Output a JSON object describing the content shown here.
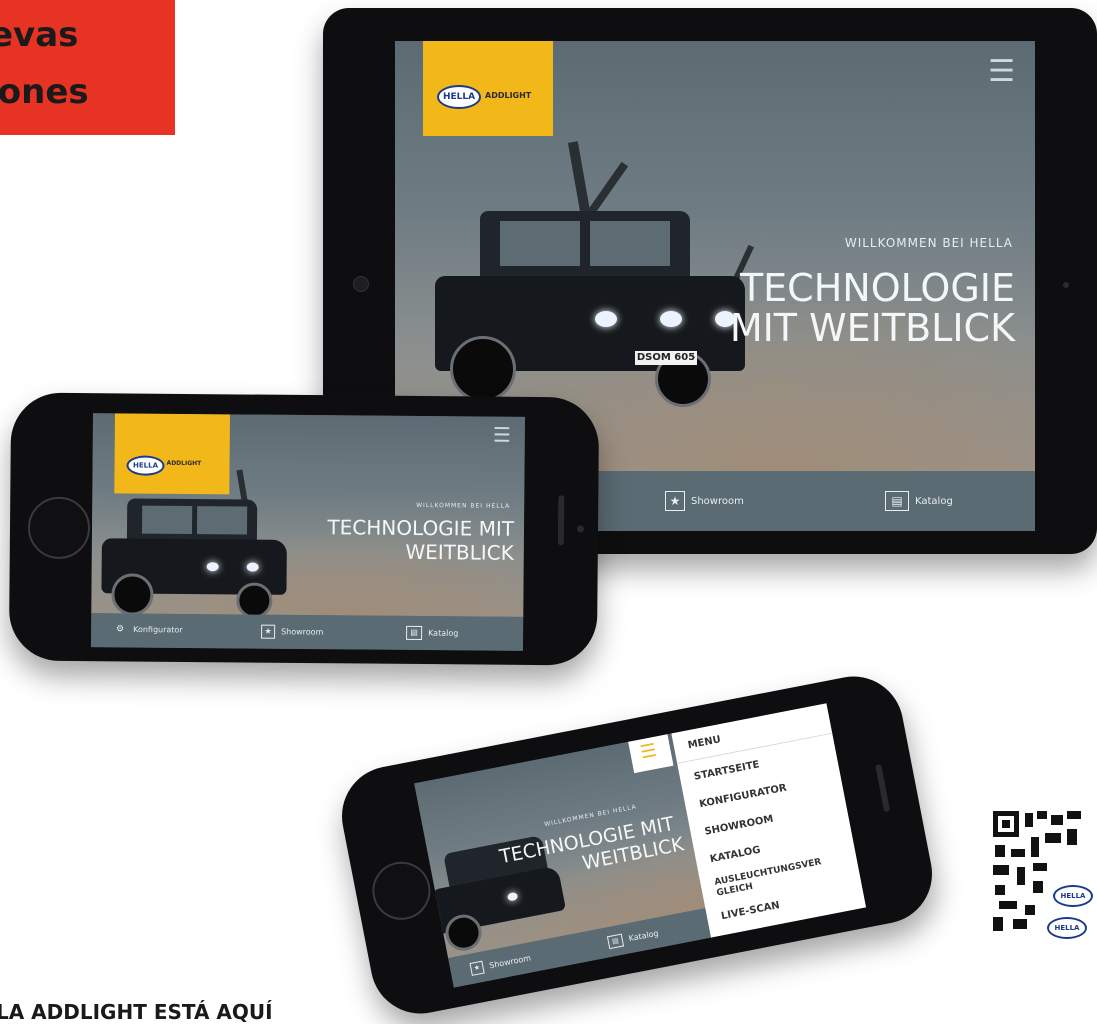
{
  "badge": {
    "line1": "evas",
    "line2": "ciones"
  },
  "brand": {
    "logo_mark": "HELLA",
    "app_name": "ADDLIGHT",
    "accent": "#f2b719",
    "promo_color": "#e63323"
  },
  "tablet": {
    "welcome": "WILLKOMMEN BEI HELLA",
    "headline_1": "TECHNOLOGIE",
    "headline_2": "MIT WEITBLICK",
    "tabs": [
      {
        "label": "Showroom",
        "icon": "star-icon"
      },
      {
        "label": "Katalog",
        "icon": "book-icon"
      }
    ],
    "plate": "DSOM 605"
  },
  "phone1": {
    "welcome": "WILLKOMMEN BEI HELLA",
    "headline_1": "TECHNOLOGIE MIT",
    "headline_2": "WEITBLICK",
    "tabs": [
      {
        "label": "Konfigurator",
        "icon": "gears-icon"
      },
      {
        "label": "Showroom",
        "icon": "star-icon"
      },
      {
        "label": "Katalog",
        "icon": "book-icon"
      }
    ]
  },
  "phone2": {
    "welcome": "WILLKOMMEN BEI HELLA",
    "headline_1": "TECHNOLOGIE MIT",
    "headline_2": "WEITBLICK",
    "menu_title": "MENU",
    "menu_items": [
      "STARTSEITE",
      "KONFIGURATOR",
      "SHOWROOM",
      "KATALOG",
      "AUSLEUCHTUNGSVER GLEICH",
      "LIVE-SCAN"
    ],
    "tabs": [
      {
        "label": "Showroom",
        "icon": "star-icon"
      },
      {
        "label": "Katalog",
        "icon": "book-icon"
      }
    ]
  },
  "qr": {
    "logo_mark": "HELLA"
  },
  "footer": "LA ADDLIGHT ESTÁ AQUÍ"
}
